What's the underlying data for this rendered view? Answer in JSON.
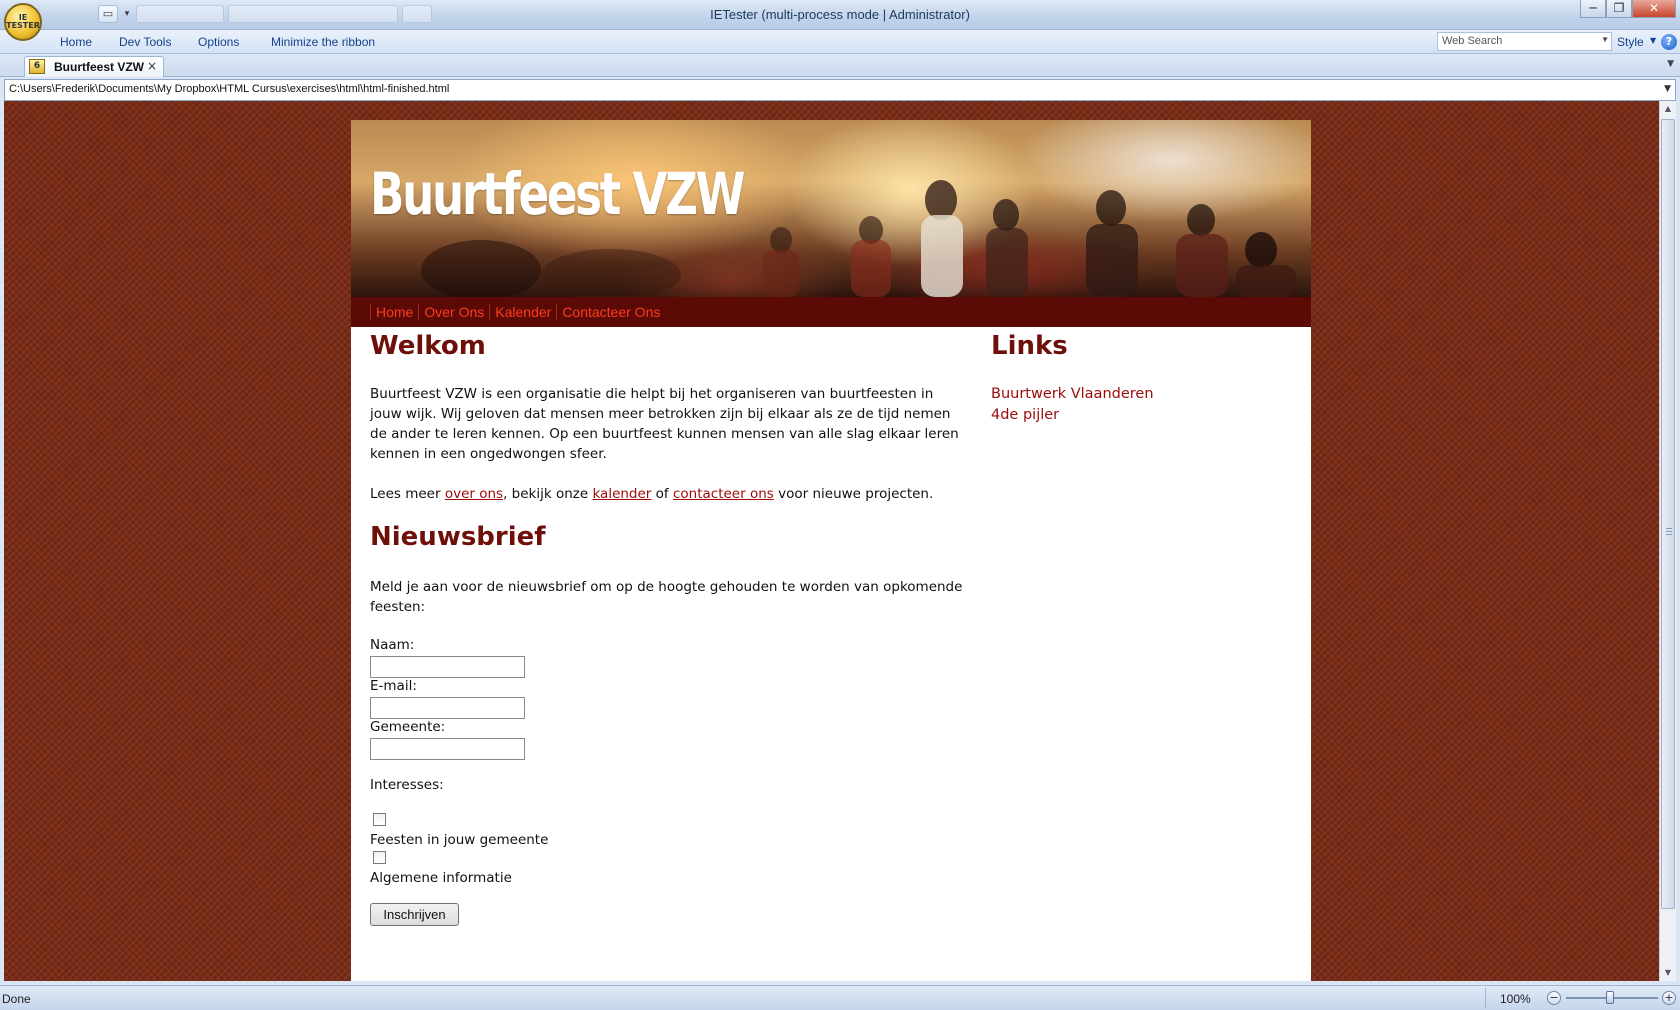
{
  "window": {
    "title": "IETester (multi-process mode | Administrator)",
    "orb_label": "IE TESTER",
    "controls": {
      "minimize": "─",
      "maximize": "❐",
      "close": "✕"
    }
  },
  "quick_access": {
    "open_icon": "folder-icon",
    "arrow": "▾"
  },
  "ribbon": {
    "tabs": [
      "Home",
      "Dev Tools",
      "Options",
      "Minimize the ribbon"
    ],
    "search_placeholder": "Web Search",
    "style_label": "Style",
    "help": "?"
  },
  "tab": {
    "version_badge": "6",
    "label": "Buurtfeest VZW",
    "close": "×"
  },
  "address": {
    "path": "C:\\Users\\Frederik\\Documents\\My Dropbox\\HTML Cursus\\exercises\\html\\html-finished.html"
  },
  "site": {
    "title": "Buurtfeest VZW",
    "nav": [
      "Home",
      "Over Ons",
      "Kalender",
      "Contacteer Ons"
    ],
    "welcome_heading": "Welkom",
    "intro": "Buurtfeest VZW is een organisatie die helpt bij het organiseren van buurtfeesten in jouw wijk. Wij geloven dat mensen meer betrokken zijn bij elkaar als ze de tijd nemen de ander te leren kennen. Op een buurtfeest kunnen mensen van alle slag elkaar leren kennen in een ongedwongen sfeer.",
    "more": {
      "prefix": "Lees meer ",
      "link1": "over ons",
      "mid1": ", bekijk onze ",
      "link2": "kalender",
      "mid2": " of ",
      "link3": "contacteer ons",
      "suffix": " voor nieuwe projecten."
    },
    "newsletter_heading": "Nieuwsbrief",
    "newsletter_intro": "Meld je aan voor de nieuwsbrief om op de hoogte gehouden te worden van opkomende feesten:",
    "form": {
      "name_label": "Naam:",
      "name_value": "",
      "email_label": "E-mail:",
      "email_value": "",
      "city_label": "Gemeente:",
      "city_value": "",
      "interests_label": "Interesses:",
      "interest1": "Feesten in jouw gemeente",
      "interest1_checked": false,
      "interest2": "Algemene informatie",
      "interest2_checked": false,
      "submit": "Inschrijven"
    },
    "links_heading": "Links",
    "links": [
      "Buurtwerk Vlaanderen",
      "4de pijler"
    ]
  },
  "status": {
    "text": "Done",
    "zoom": "100%",
    "zoom_level": 1.0
  },
  "colors": {
    "page_bg": "#7a2a14",
    "nav_bg": "#5c0a06",
    "nav_link": "#ff3a20",
    "heading": "#6e0f0a",
    "link": "#9c0a0a"
  }
}
